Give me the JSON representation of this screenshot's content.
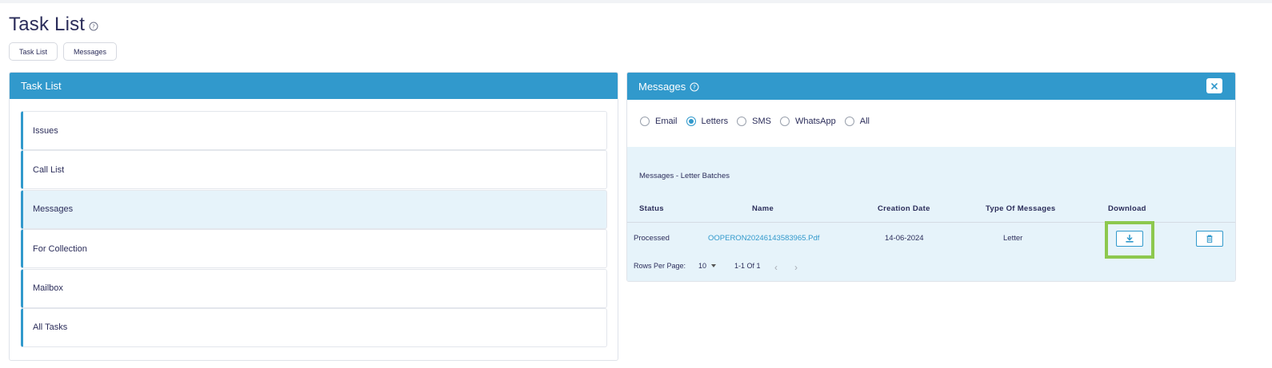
{
  "page": {
    "title": "Task List"
  },
  "breadcrumbs": [
    "Task List",
    "Messages"
  ],
  "task_panel": {
    "title": "Task List",
    "items": [
      "Issues",
      "Call List",
      "Messages",
      "For Collection",
      "Mailbox",
      "All Tasks"
    ],
    "active_item": "Messages"
  },
  "messages_panel": {
    "title": "Messages",
    "filters": [
      "Email",
      "Letters",
      "SMS",
      "WhatsApp",
      "All"
    ],
    "selected_filter": "Letters",
    "batch_title": "Messages - Letter Batches",
    "columns": [
      "Status",
      "Name",
      "Creation Date",
      "Type Of Messages",
      "Download"
    ],
    "rows": [
      {
        "status": "Processed",
        "name": "OOPERON20246143583965.Pdf",
        "creation_date": "14-06-2024",
        "type": "Letter"
      }
    ],
    "pagination": {
      "rows_per_page_label": "Rows Per Page:",
      "rows_per_page": "10",
      "range": "1-1 Of 1",
      "prev": "‹",
      "next": "›"
    }
  },
  "icons": {
    "help": "help-circle-icon",
    "close": "close-icon",
    "download": "download-icon",
    "delete": "trash-icon"
  },
  "colors": {
    "accent": "#3199cc",
    "title_text": "#2b2d5a",
    "highlight": "#8dc84e",
    "panel_bg_light": "#e6f3fa"
  }
}
